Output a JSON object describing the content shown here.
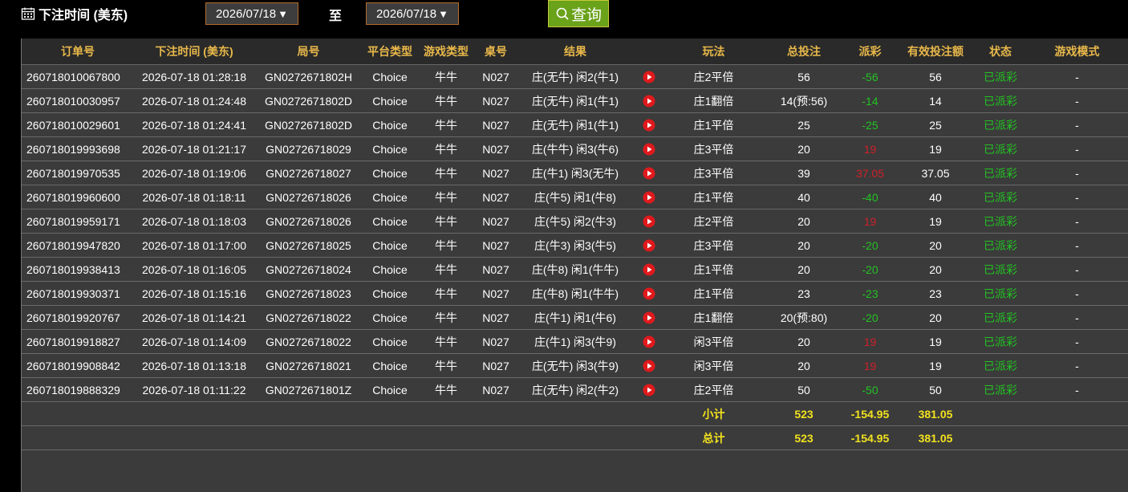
{
  "header": {
    "title": "下注时间 (美东)",
    "date_from": "2026/07/18",
    "to_label": "至",
    "date_to": "2026/07/18",
    "query_label": "查询",
    "icons": {
      "calendar": "calendar-icon",
      "search": "search-icon",
      "dropdown": "triangle-down-icon"
    }
  },
  "columns": [
    "订单号",
    "下注时间 (美东)",
    "局号",
    "平台类型",
    "游戏类型",
    "桌号",
    "结果",
    "",
    "玩法",
    "总投注",
    "派彩",
    "有效投注额",
    "状态",
    "游戏模式"
  ],
  "rows": [
    {
      "order": "260718010067800",
      "time": "2026-07-18 01:28:18",
      "round": "GN0272671802H",
      "platform": "Choice",
      "game": "牛牛",
      "table": "N027",
      "result": "庄(无牛) 闲2(牛1)",
      "play": "庄2平倍",
      "bet": "56",
      "payout": "-56",
      "payout_color": "green",
      "valid": "56",
      "status": "已派彩",
      "mode": "-"
    },
    {
      "order": "260718010030957",
      "time": "2026-07-18 01:24:48",
      "round": "GN0272671802D",
      "platform": "Choice",
      "game": "牛牛",
      "table": "N027",
      "result": "庄(无牛) 闲1(牛1)",
      "play": "庄1翻倍",
      "bet": "14(预:56)",
      "payout": "-14",
      "payout_color": "green",
      "valid": "14",
      "status": "已派彩",
      "mode": "-"
    },
    {
      "order": "260718010029601",
      "time": "2026-07-18 01:24:41",
      "round": "GN0272671802D",
      "platform": "Choice",
      "game": "牛牛",
      "table": "N027",
      "result": "庄(无牛) 闲1(牛1)",
      "play": "庄1平倍",
      "bet": "25",
      "payout": "-25",
      "payout_color": "green",
      "valid": "25",
      "status": "已派彩",
      "mode": "-"
    },
    {
      "order": "260718019993698",
      "time": "2026-07-18 01:21:17",
      "round": "GN02726718029",
      "platform": "Choice",
      "game": "牛牛",
      "table": "N027",
      "result": "庄(牛牛) 闲3(牛6)",
      "play": "庄3平倍",
      "bet": "20",
      "payout": "19",
      "payout_color": "red",
      "valid": "19",
      "status": "已派彩",
      "mode": "-"
    },
    {
      "order": "260718019970535",
      "time": "2026-07-18 01:19:06",
      "round": "GN02726718027",
      "platform": "Choice",
      "game": "牛牛",
      "table": "N027",
      "result": "庄(牛1) 闲3(无牛)",
      "play": "庄3平倍",
      "bet": "39",
      "payout": "37.05",
      "payout_color": "red",
      "valid": "37.05",
      "status": "已派彩",
      "mode": "-"
    },
    {
      "order": "260718019960600",
      "time": "2026-07-18 01:18:11",
      "round": "GN02726718026",
      "platform": "Choice",
      "game": "牛牛",
      "table": "N027",
      "result": "庄(牛5) 闲1(牛8)",
      "play": "庄1平倍",
      "bet": "40",
      "payout": "-40",
      "payout_color": "green",
      "valid": "40",
      "status": "已派彩",
      "mode": "-"
    },
    {
      "order": "260718019959171",
      "time": "2026-07-18 01:18:03",
      "round": "GN02726718026",
      "platform": "Choice",
      "game": "牛牛",
      "table": "N027",
      "result": "庄(牛5) 闲2(牛3)",
      "play": "庄2平倍",
      "bet": "20",
      "payout": "19",
      "payout_color": "red",
      "valid": "19",
      "status": "已派彩",
      "mode": "-"
    },
    {
      "order": "260718019947820",
      "time": "2026-07-18 01:17:00",
      "round": "GN02726718025",
      "platform": "Choice",
      "game": "牛牛",
      "table": "N027",
      "result": "庄(牛3) 闲3(牛5)",
      "play": "庄3平倍",
      "bet": "20",
      "payout": "-20",
      "payout_color": "green",
      "valid": "20",
      "status": "已派彩",
      "mode": "-"
    },
    {
      "order": "260718019938413",
      "time": "2026-07-18 01:16:05",
      "round": "GN02726718024",
      "platform": "Choice",
      "game": "牛牛",
      "table": "N027",
      "result": "庄(牛8) 闲1(牛牛)",
      "play": "庄1平倍",
      "bet": "20",
      "payout": "-20",
      "payout_color": "green",
      "valid": "20",
      "status": "已派彩",
      "mode": "-"
    },
    {
      "order": "260718019930371",
      "time": "2026-07-18 01:15:16",
      "round": "GN02726718023",
      "platform": "Choice",
      "game": "牛牛",
      "table": "N027",
      "result": "庄(牛8) 闲1(牛牛)",
      "play": "庄1平倍",
      "bet": "23",
      "payout": "-23",
      "payout_color": "green",
      "valid": "23",
      "status": "已派彩",
      "mode": "-"
    },
    {
      "order": "260718019920767",
      "time": "2026-07-18 01:14:21",
      "round": "GN02726718022",
      "platform": "Choice",
      "game": "牛牛",
      "table": "N027",
      "result": "庄(牛1) 闲1(牛6)",
      "play": "庄1翻倍",
      "bet": "20(预:80)",
      "payout": "-20",
      "payout_color": "green",
      "valid": "20",
      "status": "已派彩",
      "mode": "-"
    },
    {
      "order": "260718019918827",
      "time": "2026-07-18 01:14:09",
      "round": "GN02726718022",
      "platform": "Choice",
      "game": "牛牛",
      "table": "N027",
      "result": "庄(牛1) 闲3(牛9)",
      "play": "闲3平倍",
      "bet": "20",
      "payout": "19",
      "payout_color": "red",
      "valid": "19",
      "status": "已派彩",
      "mode": "-"
    },
    {
      "order": "260718019908842",
      "time": "2026-07-18 01:13:18",
      "round": "GN02726718021",
      "platform": "Choice",
      "game": "牛牛",
      "table": "N027",
      "result": "庄(无牛) 闲3(牛9)",
      "play": "闲3平倍",
      "bet": "20",
      "payout": "19",
      "payout_color": "red",
      "valid": "19",
      "status": "已派彩",
      "mode": "-"
    },
    {
      "order": "260718019888329",
      "time": "2026-07-18 01:11:22",
      "round": "GN0272671801Z",
      "platform": "Choice",
      "game": "牛牛",
      "table": "N027",
      "result": "庄(无牛) 闲2(牛2)",
      "play": "庄2平倍",
      "bet": "50",
      "payout": "-50",
      "payout_color": "green",
      "valid": "50",
      "status": "已派彩",
      "mode": "-"
    }
  ],
  "subtotal": {
    "label": "小计",
    "bet": "523",
    "payout": "-154.95",
    "valid": "381.05"
  },
  "total": {
    "label": "总计",
    "bet": "523",
    "payout": "-154.95",
    "valid": "381.05"
  },
  "colors": {
    "header_text": "#e8b84a",
    "status_green": "#22c322",
    "payout_red": "#d0202a",
    "summary_yellow": "#f2e21e",
    "query_button": "#6aa21a"
  }
}
